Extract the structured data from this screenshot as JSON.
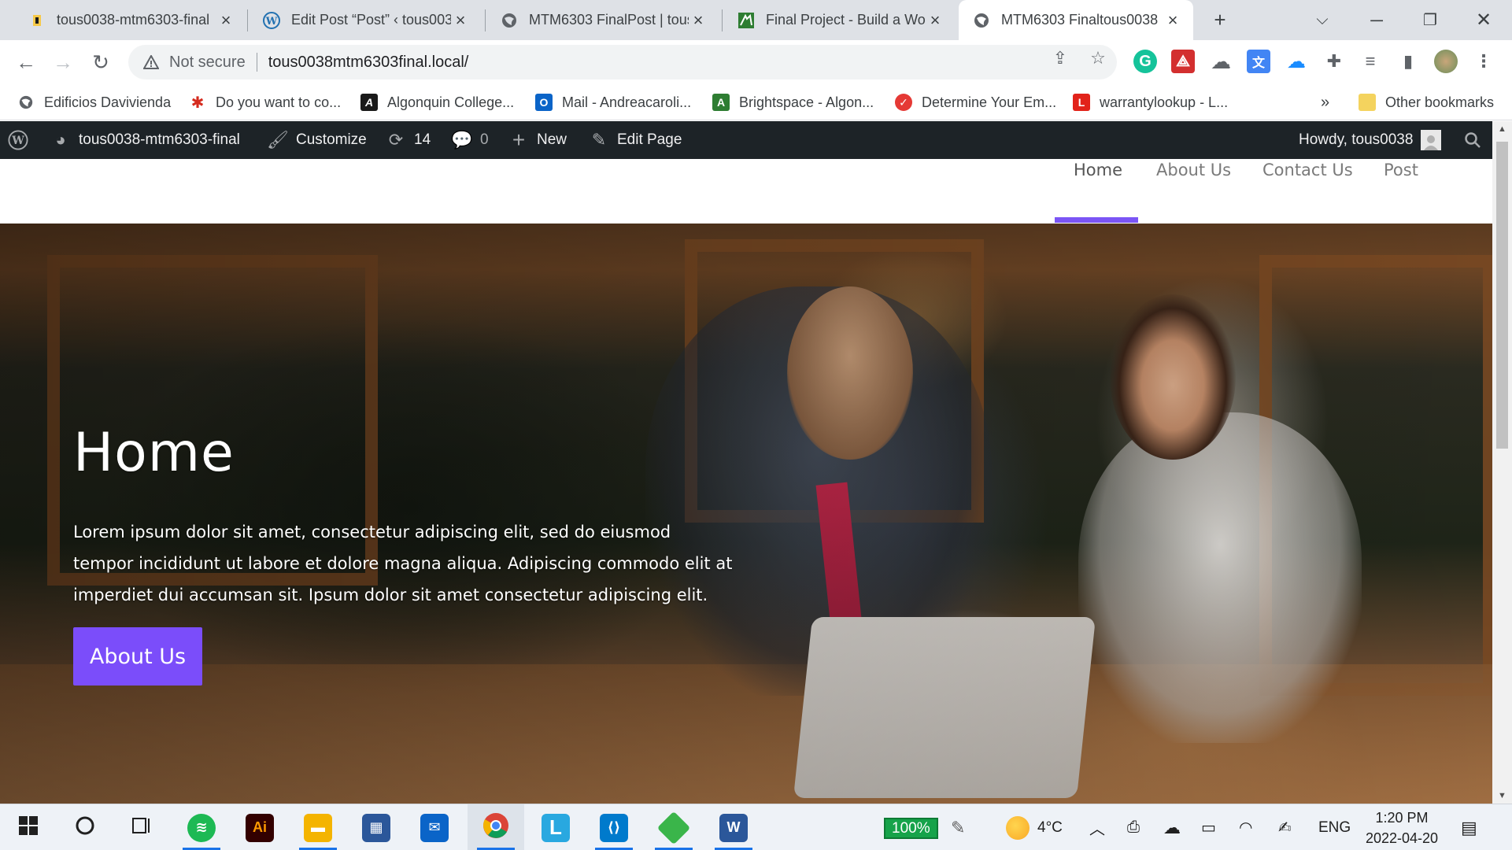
{
  "browser": {
    "tabs": [
      {
        "title": "tous0038-mtm6303-final",
        "icon": "site-favicon-icon",
        "active": false
      },
      {
        "title": "Edit Post “Post” ‹ tous0038",
        "icon": "wordpress-icon",
        "active": false
      },
      {
        "title": "MTM6303 FinalPost | tous",
        "icon": "globe-icon",
        "active": false
      },
      {
        "title": "Final Project - Build a Wo",
        "icon": "brightspace-icon",
        "active": false
      },
      {
        "title": "MTM6303 Finaltous0038",
        "icon": "globe-icon",
        "active": true
      }
    ],
    "new_tab_label": "+",
    "address": {
      "security_label": "Not secure",
      "url": "tous0038mtm6303final.local/"
    },
    "bookmarks": [
      {
        "label": "Edificios Davivienda",
        "icon": "globe-icon",
        "color": "#5f6368"
      },
      {
        "label": "Do you want to co...",
        "icon": "maple-leaf-icon",
        "color": "#d52b1e"
      },
      {
        "label": "Algonquin College...",
        "icon": "algonquin-icon",
        "color": "#1a1a1a"
      },
      {
        "label": "Mail - Andreacaroli...",
        "icon": "outlook-icon",
        "color": "#0a64c8"
      },
      {
        "label": "Brightspace - Algon...",
        "icon": "brightspace-icon",
        "color": "#2e7d32"
      },
      {
        "label": "Determine Your Em...",
        "icon": "check-circle-icon",
        "color": "#e53935"
      },
      {
        "label": "warrantylookup - L...",
        "icon": "lenovo-icon",
        "color": "#e2231a"
      }
    ],
    "bookmarks_overflow": "»",
    "other_bookmarks": "Other bookmarks"
  },
  "wp_admin_bar": {
    "site_name": "tous0038-mtm6303-final",
    "customize": "Customize",
    "updates_count": "14",
    "comments_count": "0",
    "new": "New",
    "edit_page": "Edit Page",
    "howdy": "Howdy, tous0038"
  },
  "site": {
    "menu": [
      {
        "label": "Home",
        "current": true
      },
      {
        "label": "About Us",
        "current": false
      },
      {
        "label": "Contact Us",
        "current": false
      },
      {
        "label": "Post",
        "current": false
      }
    ],
    "accent": "#7b4dfa",
    "hero": {
      "title": "Home",
      "text": "Lorem ipsum dolor sit amet, consectetur adipiscing elit, sed do eiusmod tempor incididunt ut labore et dolore magna aliqua. Adipiscing commodo elit at imperdiet dui accumsan sit. Ipsum dolor sit amet consectetur adipiscing elit.",
      "button_label": "About Us"
    }
  },
  "taskbar": {
    "apps": [
      {
        "name": "spotify",
        "glyph": "◉",
        "color": "#1db954",
        "open": true
      },
      {
        "name": "illustrator",
        "glyph": "Ai",
        "color": "#330000",
        "open": false
      },
      {
        "name": "file-explorer",
        "glyph": "▣",
        "color": "#f4b400",
        "open": true
      },
      {
        "name": "microsoft-store",
        "glyph": "▦",
        "color": "#2b579a",
        "open": false
      },
      {
        "name": "mail",
        "glyph": "✉",
        "color": "#0a64c8",
        "open": false
      },
      {
        "name": "chrome",
        "glyph": "●",
        "color": "#db4437",
        "open": true
      },
      {
        "name": "l-app",
        "glyph": "L",
        "color": "#29a8e0",
        "open": false
      },
      {
        "name": "vscode",
        "glyph": "❯",
        "color": "#007acc",
        "open": true
      },
      {
        "name": "gitkraken",
        "glyph": "◈",
        "color": "#3ab54a",
        "open": true
      },
      {
        "name": "word",
        "glyph": "W",
        "color": "#2b579a",
        "open": true
      }
    ],
    "battery": "100%",
    "weather": "4°C",
    "language": "ENG",
    "time": "1:20 PM",
    "date": "2022-04-20"
  }
}
